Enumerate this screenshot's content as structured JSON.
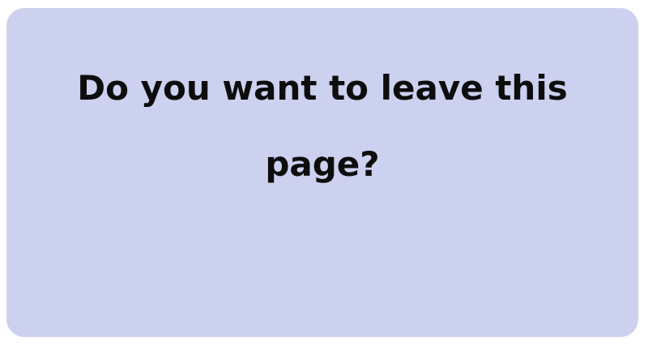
{
  "dialog": {
    "message": "Do you want to leave this page?",
    "background_color": "#cbd1ee",
    "text_color": "#0d0d0d"
  }
}
